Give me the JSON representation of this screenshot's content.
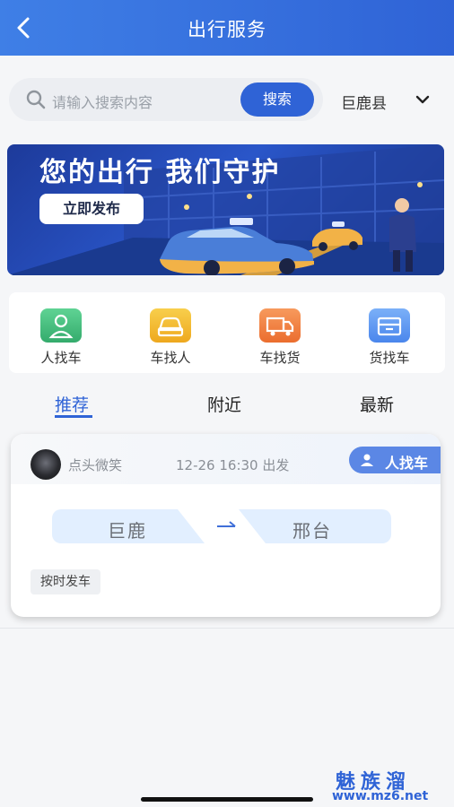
{
  "header": {
    "title": "出行服务",
    "back_icon": "back-arrow-icon"
  },
  "search": {
    "placeholder": "请输入搜索内容",
    "button_label": "搜索",
    "city": "巨鹿县",
    "search_icon": "search-icon"
  },
  "banner": {
    "headline": "您的出行 我们守护",
    "button_label": "立即发布"
  },
  "categories": [
    {
      "label": "人找车",
      "color": "#3fb97a",
      "icon": "person-icon"
    },
    {
      "label": "车找人",
      "color": "#f2b427",
      "icon": "car-icon"
    },
    {
      "label": "车找货",
      "color": "#f07a3e",
      "icon": "truck-icon"
    },
    {
      "label": "货找车",
      "color": "#4f8ff0",
      "icon": "box-icon"
    }
  ],
  "tabs": [
    {
      "label": "推荐",
      "active": true
    },
    {
      "label": "附近",
      "active": false
    },
    {
      "label": "最新",
      "active": false
    }
  ],
  "listings": [
    {
      "username": "点头微笑",
      "depart_time": "12-26 16:30 出发",
      "type": "人找车",
      "from": "巨鹿",
      "to": "邢台",
      "tag": "按时发车"
    }
  ],
  "watermark": {
    "brand": "魅族溜",
    "url": "www.mz6.net"
  },
  "colors": {
    "primary": "#2f63d6",
    "route_bg": "#e2efff"
  }
}
